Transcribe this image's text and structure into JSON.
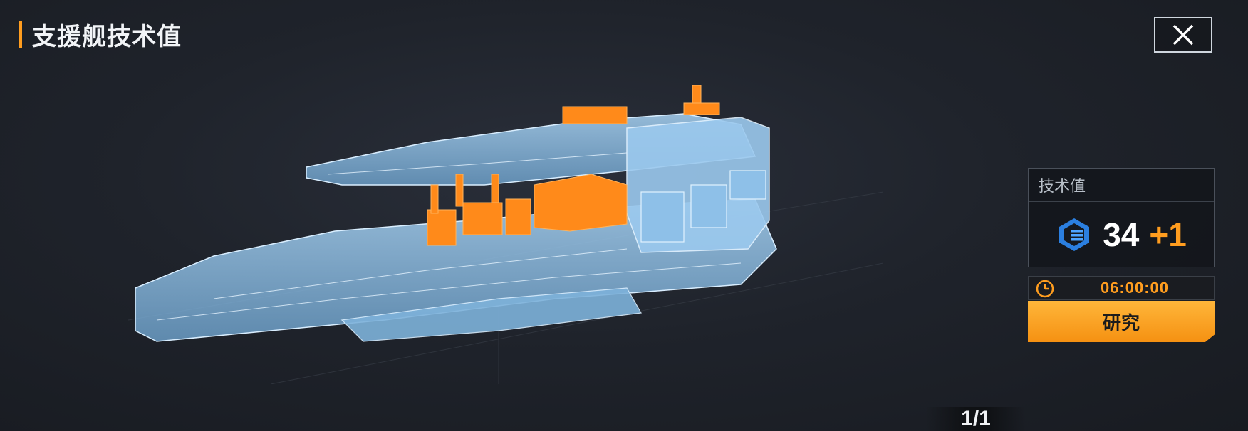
{
  "header": {
    "title": "支援舰技术值"
  },
  "close": {
    "icon": "close-icon"
  },
  "tech_panel": {
    "label": "技术值",
    "icon": "tech-value-icon",
    "value": "34",
    "bonus": "+1"
  },
  "research": {
    "timer_icon": "clock-icon",
    "time": "06:00:00",
    "button_label": "研究"
  },
  "pager": {
    "text": "1/1"
  },
  "colors": {
    "accent": "#ff9d1f",
    "hologram": "#8fc6f2",
    "highlight": "#ff8a1a"
  }
}
